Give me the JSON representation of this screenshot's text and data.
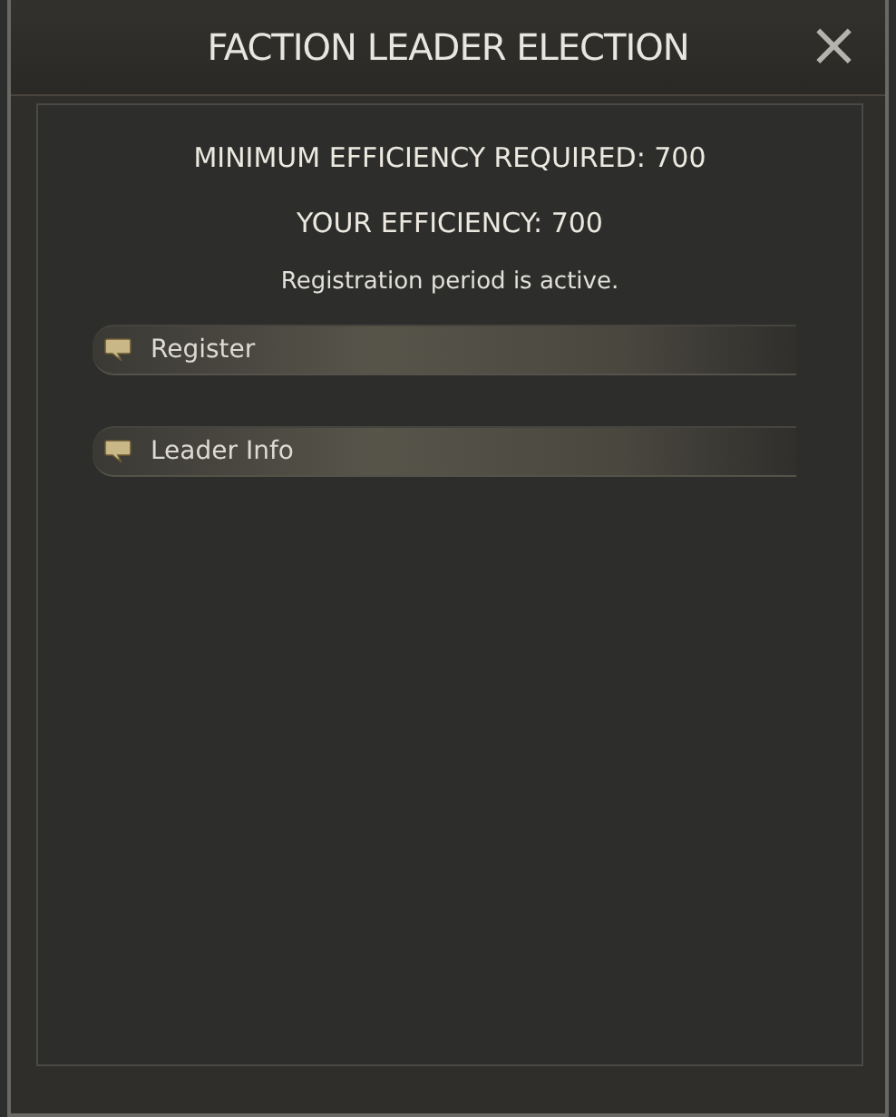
{
  "window": {
    "title": "FACTION LEADER ELECTION",
    "close_button": "×"
  },
  "info": [
    "MINIMUM EFFICIENCY REQUIRED: 700",
    "YOUR EFFICIENCY: 700"
  ],
  "status": "Registration period is active.",
  "options": [
    {
      "label": "Register"
    },
    {
      "label": "Leader Info"
    }
  ]
}
